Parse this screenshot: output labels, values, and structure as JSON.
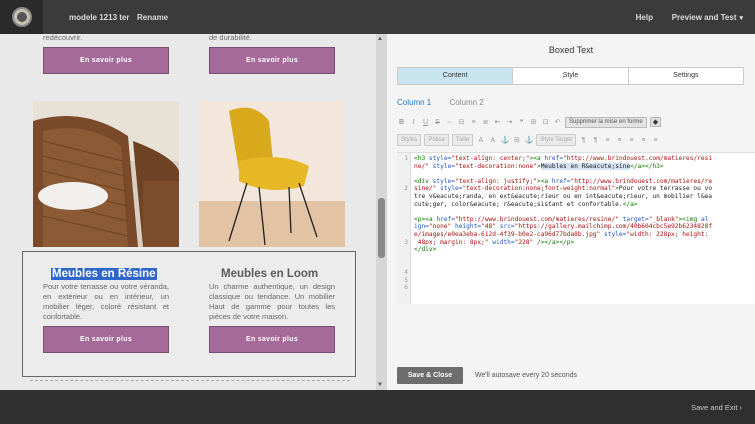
{
  "topbar": {
    "campaign_name": "modele 1213 ter",
    "rename": "Rename",
    "help": "Help",
    "preview": "Preview and Test",
    "caret": "▾"
  },
  "preview": {
    "top_left_text": "redécouvrir.",
    "top_right_text": "de durabilité.",
    "button_label": "En savoir plus",
    "block_left": {
      "heading": "Meubles en Résine",
      "text": "Pour votre terrasse ou votre véranda, en extérieur ou en intérieur, un mobilier léger, coloré résistant et confortable."
    },
    "block_right": {
      "heading": "Meubles en Loom",
      "text": "Un charme authentique, un design classique ou tendance. Un mobilier Haut de gamme pour toutes les pièces de votre maison."
    }
  },
  "editor": {
    "title": "Boxed Text",
    "tabs": [
      "Content",
      "Style",
      "Settings"
    ],
    "columns": [
      "Column 1",
      "Column 2"
    ],
    "toolbar_row1": [
      "B",
      "I",
      "U",
      "S",
      "⇔",
      "⊟",
      "≡",
      "≣",
      "⇤",
      "⇥",
      "❝",
      "⊞",
      "⊡",
      "↶"
    ],
    "remove_format": "Supprimer la mise en forme",
    "toolbar_row2_drops": [
      "Styles",
      "Police",
      "Taille",
      "Style Target"
    ],
    "toolbar_row2_btns": [
      "A",
      "A",
      "⚓",
      "⊞",
      "⚓",
      "¶",
      "¶",
      "≡",
      "≡",
      "≡",
      "≡",
      "≡"
    ],
    "line_numbers": [
      "1",
      "",
      "2",
      "",
      "",
      "",
      "",
      "3",
      "",
      "",
      "",
      "4",
      "5",
      "6"
    ],
    "save_close": "Save & Close",
    "autosave": "We'll autosave every 20 seconds"
  },
  "bottombar": {
    "save_exit": "Save and Exit",
    "chevron": "›"
  },
  "colors": {
    "button_purple": "#a5699a",
    "tab_active": "#c8e4ef",
    "heading_highlight": "#2f66c9",
    "link_blue": "#2b7bb9"
  }
}
